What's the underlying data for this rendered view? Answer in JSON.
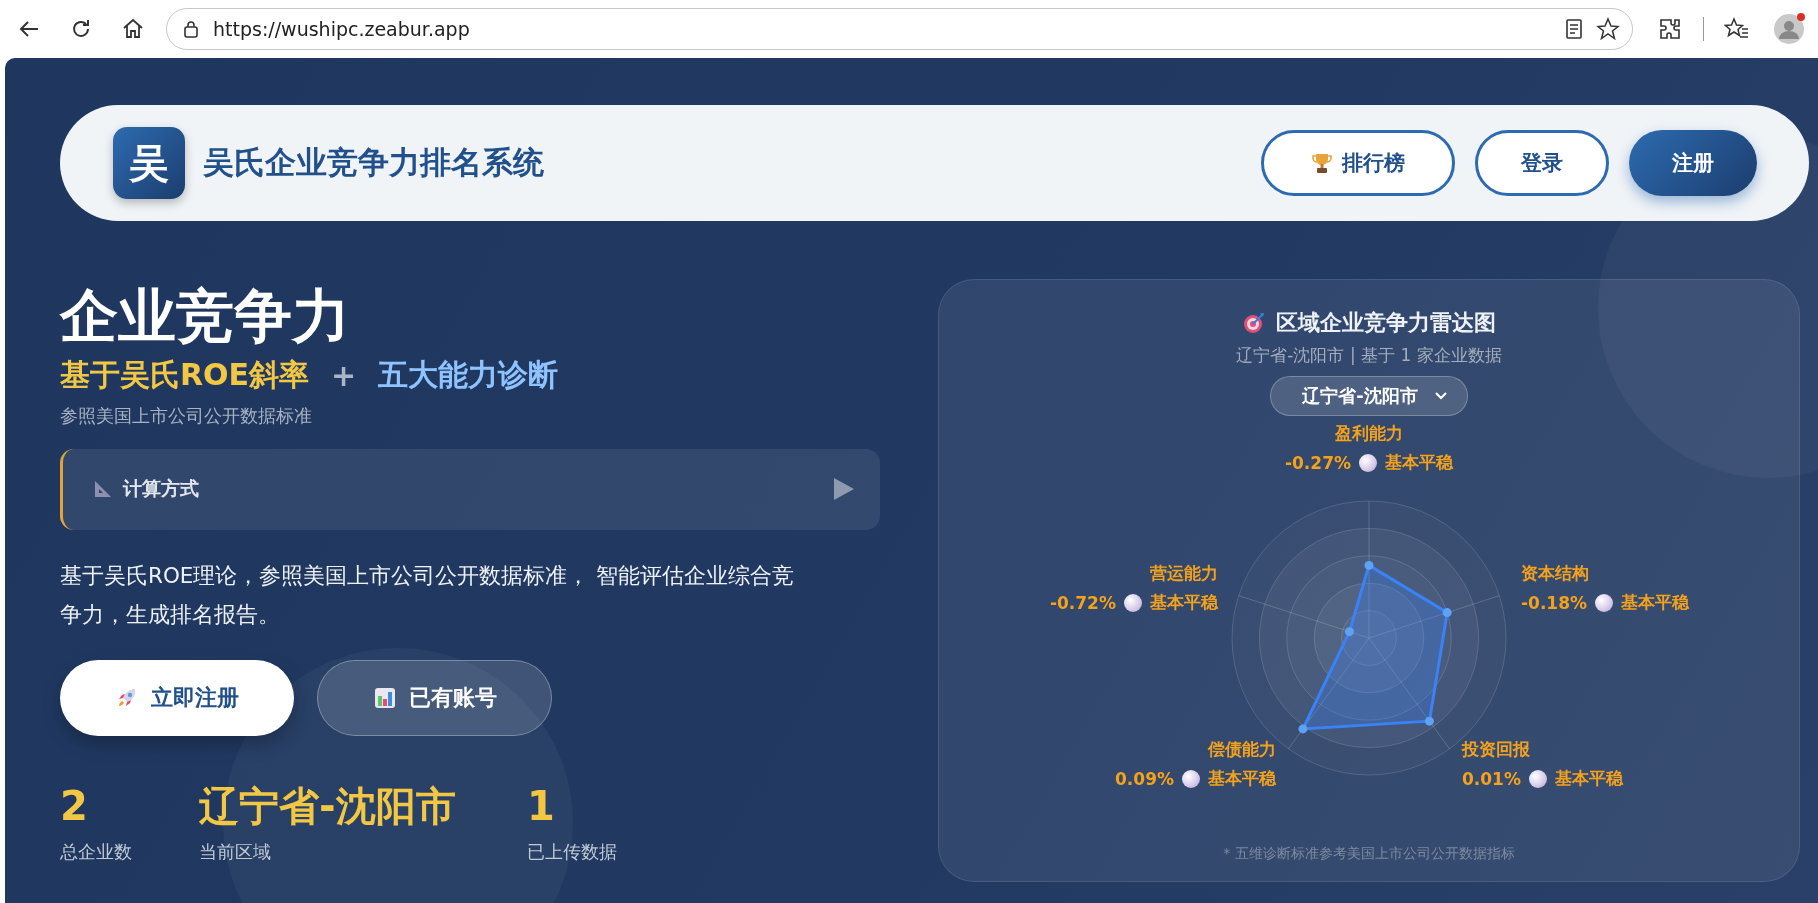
{
  "browser": {
    "url": "https://wushipc.zeabur.app"
  },
  "header": {
    "logo": "吴",
    "title": "吴氏企业竞争力排名系统",
    "buttons": [
      {
        "label": "排行榜",
        "kind": "trophy"
      },
      {
        "label": "登录",
        "kind": "outline"
      },
      {
        "label": "注册",
        "kind": "filled"
      }
    ]
  },
  "hero": {
    "title": "企业竞争力",
    "tagline": [
      {
        "text": "基于吴氏ROE斜率",
        "color": "#f2c744"
      },
      {
        "text": "+",
        "color": "#aab4c4"
      },
      {
        "text": "五大能力诊断",
        "color": "#8fc3ff"
      }
    ],
    "subtitle": "参照美国上市公司公开数据标准",
    "method": {
      "label": "计算方式",
      "expanded": false
    },
    "description": "基于吴氏ROE理论，参照美国上市公司公开数据标准， 智能评估企业综合竞争力，生成排名报告。",
    "cta": [
      {
        "label": "立即注册",
        "kind": "primary"
      },
      {
        "label": "已有账号",
        "kind": "secondary"
      }
    ],
    "stats": [
      {
        "value": "2",
        "label": "总企业数"
      },
      {
        "value": "辽宁省-沈阳市",
        "label": "当前区域"
      },
      {
        "value": "1",
        "label": "已上传数据"
      }
    ]
  },
  "radar": {
    "title": "区域企业竞争力雷达图",
    "subtitle": "辽宁省-沈阳市 | 基于 1 家企业数据",
    "region": "辽宁省-沈阳市",
    "axes": [
      {
        "name": "盈利能力",
        "value": "-0.27%",
        "status": "基本平稳"
      },
      {
        "name": "营运能力",
        "value": "-0.72%",
        "status": "基本平稳"
      },
      {
        "name": "资本结构",
        "value": "-0.18%",
        "status": "基本平稳"
      },
      {
        "name": "偿债能力",
        "value": "0.09%",
        "status": "基本平稳"
      },
      {
        "name": "投资回报",
        "value": "0.01%",
        "status": "基本平稳"
      }
    ],
    "footnote": "* 五维诊断标准参考美国上市公司公开数据指标"
  }
}
